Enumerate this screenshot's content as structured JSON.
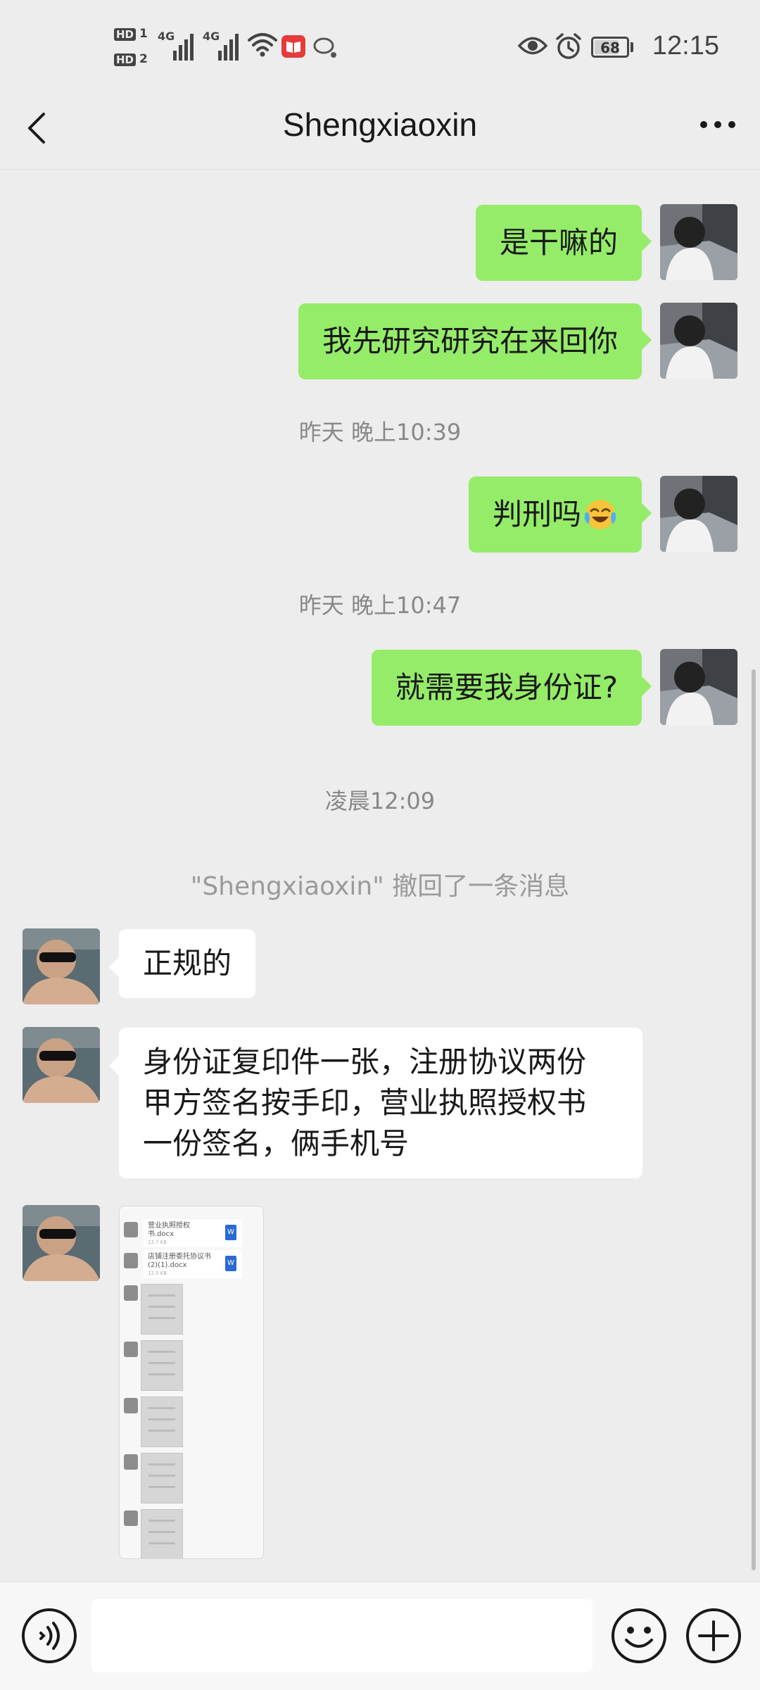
{
  "status_bar": {
    "time": "12:15",
    "battery": "68",
    "hd1": "HD",
    "sim1": "1",
    "hd2": "HD",
    "sim2": "2",
    "net1": "4G",
    "net2": "4G",
    "icons": [
      "wifi-icon",
      "book-app-icon",
      "chat-notify-icon",
      "eye-icon",
      "alarm-icon",
      "battery-icon"
    ]
  },
  "header": {
    "title": "Shengxiaoxin",
    "back_icon": "chevron-left-icon",
    "more_icon": "more-dots-icon"
  },
  "messages": {
    "m1": "是干嘛的",
    "m2": "我先研究研究在来回你",
    "t1": "昨天 晚上10:39",
    "m3": "判刑吗",
    "m3_emoji": "crying-laughing-emoji",
    "t2": "昨天 晚上10:47",
    "m4": "就需要我身份证?",
    "t3": "凌晨12:09",
    "recall": "\"Shengxiaoxin\" 撤回了一条消息",
    "m5": "正规的",
    "m6_line1": "身份证复印件一张，注册协议两份",
    "m6_line2": "甲方签名按手印，营业执照授权书",
    "m6_line3": "一份签名，俩手机号"
  },
  "image_message": {
    "doc1_title": "营业执照授权书.docx",
    "doc1_size": "12.7 KB",
    "doc2_title": "店铺注册委托协议书(2)(1).docx",
    "doc2_size": "12.0 KB",
    "word_glyph": "W"
  },
  "input_bar": {
    "voice_icon": "voice-icon",
    "emoji_icon": "emoji-icon",
    "plus_icon": "plus-icon",
    "placeholder": ""
  },
  "colors": {
    "outgoing_bubble": "#95ec69",
    "incoming_bubble": "#ffffff",
    "background": "#ededed"
  }
}
